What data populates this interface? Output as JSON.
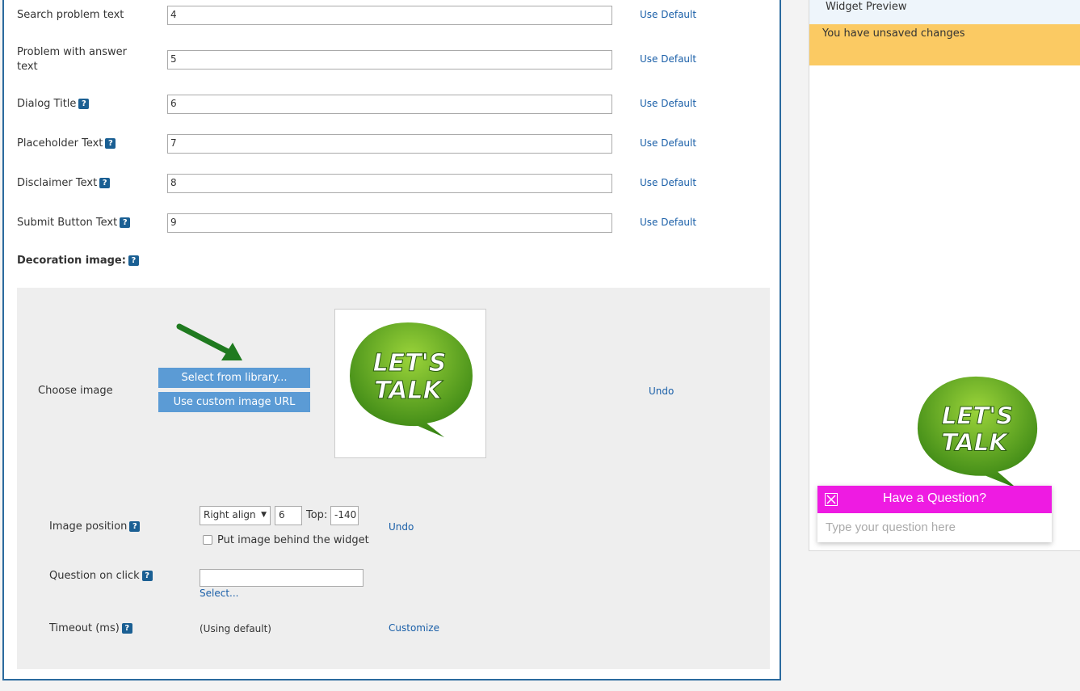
{
  "form": {
    "rows": [
      {
        "label": "Search problem text",
        "value": "4",
        "link": "Use Default",
        "help": false
      },
      {
        "label": "Problem with answer text",
        "value": "5",
        "link": "Use Default",
        "help": false
      },
      {
        "label": "Dialog Title",
        "value": "6",
        "link": "Use Default",
        "help": true
      },
      {
        "label": "Placeholder Text",
        "value": "7",
        "link": "Use Default",
        "help": true
      },
      {
        "label": "Disclaimer Text",
        "value": "8",
        "link": "Use Default",
        "help": true
      },
      {
        "label": "Submit Button Text",
        "value": "9",
        "link": "Use Default",
        "help": true
      }
    ],
    "help_glyph": "?"
  },
  "decoration": {
    "heading": "Decoration image:",
    "choose_label": "Choose image",
    "library_button": "Select from library...",
    "custom_url_button": "Use custom image URL",
    "undo": "Undo",
    "image_text_line1": "LET'S",
    "image_text_line2": "TALK",
    "position_label": "Image position",
    "align_value": "Right align",
    "offset_value": "6",
    "top_label": "Top:",
    "top_value": "-140",
    "position_undo": "Undo",
    "behind_label": "Put image behind the widget",
    "behind_checked": false,
    "question_label": "Question on click",
    "question_value": "",
    "select_link": "Select...",
    "timeout_label": "Timeout (ms)",
    "timeout_value": "(Using default)",
    "customize_link": "Customize"
  },
  "preview": {
    "header": "Widget Preview",
    "unsaved": "You have unsaved changes",
    "widget_title": "Have a Question?",
    "widget_placeholder": "Type your question here",
    "widget_color": "#ee1be2",
    "bubble_line1": "LET'S",
    "bubble_line2": "TALK"
  },
  "colors": {
    "accent": "#5b9bd5",
    "link": "#1a5fa8",
    "border": "#2b6a9e",
    "warning": "#fbca63",
    "bubble_green": "#5fa31c"
  },
  "icons": {
    "arrow": "green-arrow-icon",
    "close": "close-icon",
    "help": "help-icon"
  }
}
